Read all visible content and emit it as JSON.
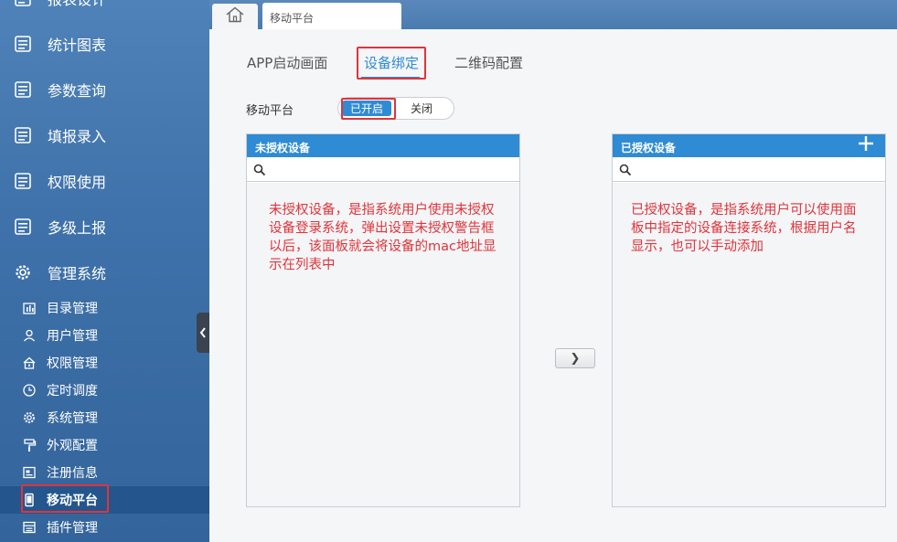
{
  "sidebar": {
    "main_items": [
      {
        "label": "报表设计",
        "icon": "report-icon"
      },
      {
        "label": "统计图表",
        "icon": "report-icon"
      },
      {
        "label": "参数查询",
        "icon": "report-icon"
      },
      {
        "label": "填报录入",
        "icon": "report-icon"
      },
      {
        "label": "权限使用",
        "icon": "report-icon"
      },
      {
        "label": "多级上报",
        "icon": "report-icon"
      },
      {
        "label": "管理系统",
        "icon": "gear-icon"
      }
    ],
    "sub_items": [
      {
        "label": "目录管理",
        "icon": "directory-icon"
      },
      {
        "label": "用户管理",
        "icon": "user-icon"
      },
      {
        "label": "权限管理",
        "icon": "lock-icon"
      },
      {
        "label": "定时调度",
        "icon": "clock-icon"
      },
      {
        "label": "系统管理",
        "icon": "gear-icon"
      },
      {
        "label": "外观配置",
        "icon": "paint-roller-icon"
      },
      {
        "label": "注册信息",
        "icon": "registration-icon"
      },
      {
        "label": "移动平台",
        "icon": "mobile-icon",
        "active": true
      },
      {
        "label": "插件管理",
        "icon": "plugin-icon"
      }
    ]
  },
  "topbar": {
    "home_icon": "home-icon",
    "active_tab": "移动平台"
  },
  "content": {
    "tabs": [
      {
        "label": "APP启动画面",
        "active": false
      },
      {
        "label": "设备绑定",
        "active": true
      },
      {
        "label": "二维码配置",
        "active": false
      }
    ],
    "mobile_platform_label": "移动平台",
    "toggle": {
      "on_label": "已开启",
      "off_label": "关闭",
      "state": "on"
    },
    "unauthorized_panel": {
      "title": "未授权设备",
      "search_placeholder": "",
      "annotation": "未授权设备，是指系统用户使用未授权设备登录系统，弹出设置未授权警告框以后，该面板就会将设备的mac地址显示在列表中"
    },
    "authorized_panel": {
      "title": "已授权设备",
      "search_placeholder": "",
      "annotation": "已授权设备，是指系统用户可以使用面板中指定的设备连接系统，根据用户名显示，也可以手动添加"
    },
    "move_button_glyph": "❯"
  },
  "colors": {
    "accent": "#2f8bd3",
    "highlight": "#e0343a",
    "sidebar_top": "#4f82b8",
    "sidebar_active": "#24558d"
  }
}
